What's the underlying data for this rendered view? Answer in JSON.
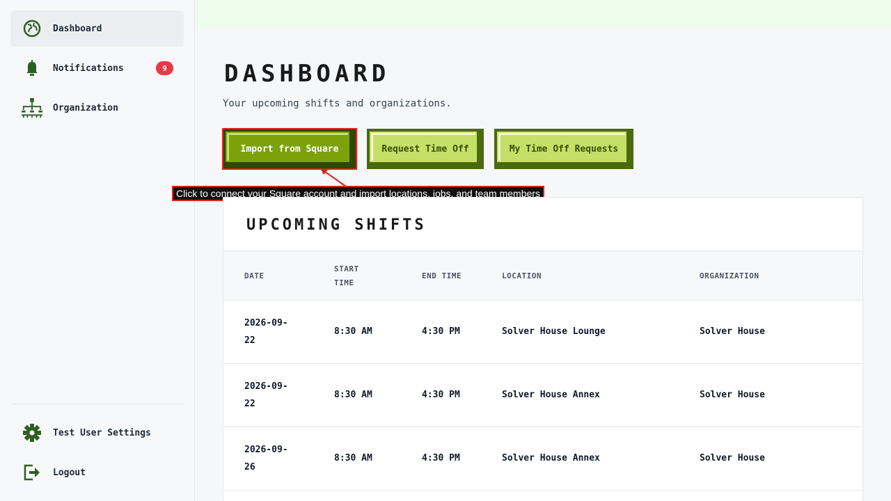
{
  "sidebar": {
    "items": [
      {
        "label": "Dashboard",
        "icon": "globe-icon",
        "active": true
      },
      {
        "label": "Notifications",
        "icon": "bell-icon",
        "badge": "9"
      },
      {
        "label": "Organization",
        "icon": "org-chart-icon"
      }
    ],
    "bottom_items": [
      {
        "label": "Test User Settings",
        "icon": "gear-icon"
      },
      {
        "label": "Logout",
        "icon": "logout-icon"
      }
    ]
  },
  "main": {
    "title": "DASHBOARD",
    "subtitle": "Your upcoming shifts and organizations.",
    "buttons": {
      "import": "Import from Square",
      "request_time_off": "Request Time Off",
      "my_time_off": "My Time Off Requests"
    },
    "tooltip": "Click to connect your Square account and import locations, jobs, and team members"
  },
  "shifts": {
    "title": "UPCOMING SHIFTS",
    "columns": {
      "date": "DATE",
      "start_time_1": "START",
      "start_time_2": "TIME",
      "end_time": "END TIME",
      "location": "LOCATION",
      "organization": "ORGANIZATION"
    },
    "rows": [
      {
        "date_1": "2026-09-",
        "date_2": "22",
        "start": "8:30 AM",
        "end": "4:30 PM",
        "location": "Solver House Lounge",
        "organization": "Solver House"
      },
      {
        "date_1": "2026-09-",
        "date_2": "22",
        "start": "8:30 AM",
        "end": "4:30 PM",
        "location": "Solver House Annex",
        "organization": "Solver House"
      },
      {
        "date_1": "2026-09-",
        "date_2": "26",
        "start": "8:30 AM",
        "end": "4:30 PM",
        "location": "Solver House Annex",
        "organization": "Solver House"
      }
    ]
  },
  "colors": {
    "accent": "#7ca20a",
    "accent_dark": "#2e4704",
    "secondary": "#c5e067",
    "icon_green": "#2f5d24",
    "badge_red": "#e63946",
    "highlight_red": "#e0201c"
  }
}
